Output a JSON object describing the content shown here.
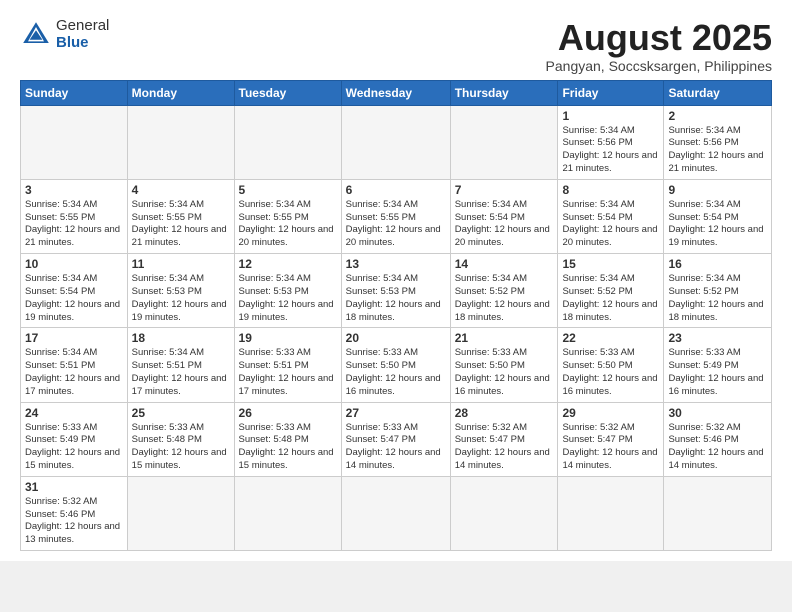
{
  "header": {
    "logo_general": "General",
    "logo_blue": "Blue",
    "month_title": "August 2025",
    "subtitle": "Pangyan, Soccsksargen, Philippines"
  },
  "days_of_week": [
    "Sunday",
    "Monday",
    "Tuesday",
    "Wednesday",
    "Thursday",
    "Friday",
    "Saturday"
  ],
  "weeks": [
    [
      {
        "day": "",
        "info": ""
      },
      {
        "day": "",
        "info": ""
      },
      {
        "day": "",
        "info": ""
      },
      {
        "day": "",
        "info": ""
      },
      {
        "day": "",
        "info": ""
      },
      {
        "day": "1",
        "info": "Sunrise: 5:34 AM\nSunset: 5:56 PM\nDaylight: 12 hours\nand 21 minutes."
      },
      {
        "day": "2",
        "info": "Sunrise: 5:34 AM\nSunset: 5:56 PM\nDaylight: 12 hours\nand 21 minutes."
      }
    ],
    [
      {
        "day": "3",
        "info": "Sunrise: 5:34 AM\nSunset: 5:55 PM\nDaylight: 12 hours\nand 21 minutes."
      },
      {
        "day": "4",
        "info": "Sunrise: 5:34 AM\nSunset: 5:55 PM\nDaylight: 12 hours\nand 21 minutes."
      },
      {
        "day": "5",
        "info": "Sunrise: 5:34 AM\nSunset: 5:55 PM\nDaylight: 12 hours\nand 20 minutes."
      },
      {
        "day": "6",
        "info": "Sunrise: 5:34 AM\nSunset: 5:55 PM\nDaylight: 12 hours\nand 20 minutes."
      },
      {
        "day": "7",
        "info": "Sunrise: 5:34 AM\nSunset: 5:54 PM\nDaylight: 12 hours\nand 20 minutes."
      },
      {
        "day": "8",
        "info": "Sunrise: 5:34 AM\nSunset: 5:54 PM\nDaylight: 12 hours\nand 20 minutes."
      },
      {
        "day": "9",
        "info": "Sunrise: 5:34 AM\nSunset: 5:54 PM\nDaylight: 12 hours\nand 19 minutes."
      }
    ],
    [
      {
        "day": "10",
        "info": "Sunrise: 5:34 AM\nSunset: 5:54 PM\nDaylight: 12 hours\nand 19 minutes."
      },
      {
        "day": "11",
        "info": "Sunrise: 5:34 AM\nSunset: 5:53 PM\nDaylight: 12 hours\nand 19 minutes."
      },
      {
        "day": "12",
        "info": "Sunrise: 5:34 AM\nSunset: 5:53 PM\nDaylight: 12 hours\nand 19 minutes."
      },
      {
        "day": "13",
        "info": "Sunrise: 5:34 AM\nSunset: 5:53 PM\nDaylight: 12 hours\nand 18 minutes."
      },
      {
        "day": "14",
        "info": "Sunrise: 5:34 AM\nSunset: 5:52 PM\nDaylight: 12 hours\nand 18 minutes."
      },
      {
        "day": "15",
        "info": "Sunrise: 5:34 AM\nSunset: 5:52 PM\nDaylight: 12 hours\nand 18 minutes."
      },
      {
        "day": "16",
        "info": "Sunrise: 5:34 AM\nSunset: 5:52 PM\nDaylight: 12 hours\nand 18 minutes."
      }
    ],
    [
      {
        "day": "17",
        "info": "Sunrise: 5:34 AM\nSunset: 5:51 PM\nDaylight: 12 hours\nand 17 minutes."
      },
      {
        "day": "18",
        "info": "Sunrise: 5:34 AM\nSunset: 5:51 PM\nDaylight: 12 hours\nand 17 minutes."
      },
      {
        "day": "19",
        "info": "Sunrise: 5:33 AM\nSunset: 5:51 PM\nDaylight: 12 hours\nand 17 minutes."
      },
      {
        "day": "20",
        "info": "Sunrise: 5:33 AM\nSunset: 5:50 PM\nDaylight: 12 hours\nand 16 minutes."
      },
      {
        "day": "21",
        "info": "Sunrise: 5:33 AM\nSunset: 5:50 PM\nDaylight: 12 hours\nand 16 minutes."
      },
      {
        "day": "22",
        "info": "Sunrise: 5:33 AM\nSunset: 5:50 PM\nDaylight: 12 hours\nand 16 minutes."
      },
      {
        "day": "23",
        "info": "Sunrise: 5:33 AM\nSunset: 5:49 PM\nDaylight: 12 hours\nand 16 minutes."
      }
    ],
    [
      {
        "day": "24",
        "info": "Sunrise: 5:33 AM\nSunset: 5:49 PM\nDaylight: 12 hours\nand 15 minutes."
      },
      {
        "day": "25",
        "info": "Sunrise: 5:33 AM\nSunset: 5:48 PM\nDaylight: 12 hours\nand 15 minutes."
      },
      {
        "day": "26",
        "info": "Sunrise: 5:33 AM\nSunset: 5:48 PM\nDaylight: 12 hours\nand 15 minutes."
      },
      {
        "day": "27",
        "info": "Sunrise: 5:33 AM\nSunset: 5:47 PM\nDaylight: 12 hours\nand 14 minutes."
      },
      {
        "day": "28",
        "info": "Sunrise: 5:32 AM\nSunset: 5:47 PM\nDaylight: 12 hours\nand 14 minutes."
      },
      {
        "day": "29",
        "info": "Sunrise: 5:32 AM\nSunset: 5:47 PM\nDaylight: 12 hours\nand 14 minutes."
      },
      {
        "day": "30",
        "info": "Sunrise: 5:32 AM\nSunset: 5:46 PM\nDaylight: 12 hours\nand 14 minutes."
      }
    ],
    [
      {
        "day": "31",
        "info": "Sunrise: 5:32 AM\nSunset: 5:46 PM\nDaylight: 12 hours\nand 13 minutes."
      },
      {
        "day": "",
        "info": ""
      },
      {
        "day": "",
        "info": ""
      },
      {
        "day": "",
        "info": ""
      },
      {
        "day": "",
        "info": ""
      },
      {
        "day": "",
        "info": ""
      },
      {
        "day": "",
        "info": ""
      }
    ]
  ]
}
